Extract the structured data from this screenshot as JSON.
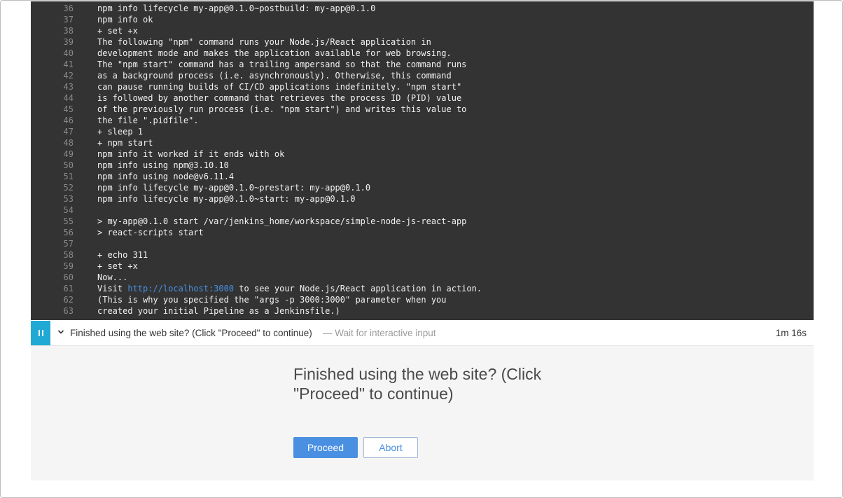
{
  "console": {
    "lines": [
      {
        "num": "36",
        "text": "npm info lifecycle my-app@0.1.0~postbuild: my-app@0.1.0"
      },
      {
        "num": "37",
        "text": "npm info ok"
      },
      {
        "num": "38",
        "text": "+ set +x"
      },
      {
        "num": "39",
        "text": "The following \"npm\" command runs your Node.js/React application in"
      },
      {
        "num": "40",
        "text": "development mode and makes the application available for web browsing."
      },
      {
        "num": "41",
        "text": "The \"npm start\" command has a trailing ampersand so that the command runs"
      },
      {
        "num": "42",
        "text": "as a background process (i.e. asynchronously). Otherwise, this command"
      },
      {
        "num": "43",
        "text": "can pause running builds of CI/CD applications indefinitely. \"npm start\""
      },
      {
        "num": "44",
        "text": "is followed by another command that retrieves the process ID (PID) value"
      },
      {
        "num": "45",
        "text": "of the previously run process (i.e. \"npm start\") and writes this value to"
      },
      {
        "num": "46",
        "text": "the file \".pidfile\"."
      },
      {
        "num": "47",
        "text": "+ sleep 1"
      },
      {
        "num": "48",
        "text": "+ npm start"
      },
      {
        "num": "49",
        "text": "npm info it worked if it ends with ok"
      },
      {
        "num": "50",
        "text": "npm info using npm@3.10.10"
      },
      {
        "num": "51",
        "text": "npm info using node@v6.11.4"
      },
      {
        "num": "52",
        "text": "npm info lifecycle my-app@0.1.0~prestart: my-app@0.1.0"
      },
      {
        "num": "53",
        "text": "npm info lifecycle my-app@0.1.0~start: my-app@0.1.0"
      },
      {
        "num": "54",
        "text": ""
      },
      {
        "num": "55",
        "text": "> my-app@0.1.0 start /var/jenkins_home/workspace/simple-node-js-react-app"
      },
      {
        "num": "56",
        "text": "> react-scripts start"
      },
      {
        "num": "57",
        "text": ""
      },
      {
        "num": "58",
        "text": "+ echo 311"
      },
      {
        "num": "59",
        "text": "+ set +x"
      },
      {
        "num": "60",
        "text": "Now..."
      },
      {
        "num": "61",
        "text": "",
        "pre": "Visit ",
        "link": "http://localhost:3000",
        "post": " to see your Node.js/React application in action."
      },
      {
        "num": "62",
        "text": "(This is why you specified the \"args -p 3000:3000\" parameter when you"
      },
      {
        "num": "63",
        "text": "created your initial Pipeline as a Jenkinsfile.)"
      }
    ]
  },
  "step": {
    "title": "Finished using the web site? (Click \"Proceed\" to continue)",
    "subtitle": "— Wait for interactive input",
    "duration": "1m 16s",
    "icons": {
      "status": "pause-icon",
      "toggle": "chevron-down-icon"
    }
  },
  "input": {
    "message": "Finished using the web site? (Click \"Proceed\" to continue)",
    "proceed_label": "Proceed",
    "abort_label": "Abort"
  },
  "colors": {
    "console_bg": "#333333",
    "accent": "#1fa9d4",
    "primary_button": "#4a90e2",
    "link": "#4a90e2"
  }
}
